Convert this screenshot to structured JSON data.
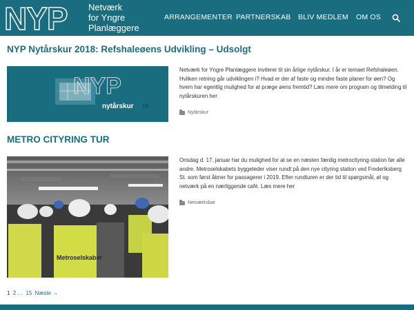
{
  "header": {
    "logo_text": "NYP",
    "tagline_lines": [
      "Netværk",
      "for Yngre",
      "Planlæggere"
    ],
    "nav": [
      "ARRANGEMENTER",
      "PARTNERSKAB",
      "BLIV MEDLEM",
      "OM OS"
    ],
    "search_icon": "search-icon"
  },
  "posts": [
    {
      "title": "NYP Nytårskur 2018: Refshaleøens Udvikling – Udsolgt",
      "thumb_logo": "NYP",
      "thumb_caption": "nytårskur",
      "thumb_year": "18",
      "excerpt": "Netværk for Yngre Planlæggere inviterer til sin årlige nytårskur. I år er temaet Refshaleøen. Hvilken retning går udviklingen i? Hvad er der af faste og mindre faste planer for øen? Og hvem har egentlig mulighed for at præge øens fremtid? Læs mere om program og tilmelding til nytårskuren her",
      "category": "Nytårskur"
    },
    {
      "title": "METRO CITYRING TUR",
      "thumb_vest_text": "Metroselskabet",
      "excerpt": "Onsdag d. 17. januar har du mulighed for at se en næsten færdig metrocityring-station før alle andre. Metroselskabets byggeleder viser rundt på den nye cityring station ved Frederiksberg St. som først åbner for passagerer i 2019. Efter rundturen er der tid til spørgsmål, øl og netværk på en nærliggende café. Læs mere her",
      "category": "Netværksbar"
    }
  ],
  "pagination": {
    "current": "1",
    "next_page": "2",
    "ellipsis": "…",
    "last_page": "15",
    "next_label": "Næste →"
  },
  "colors": {
    "brand": "#1a6d7f",
    "background": "#ffffff",
    "text": "#333333"
  }
}
